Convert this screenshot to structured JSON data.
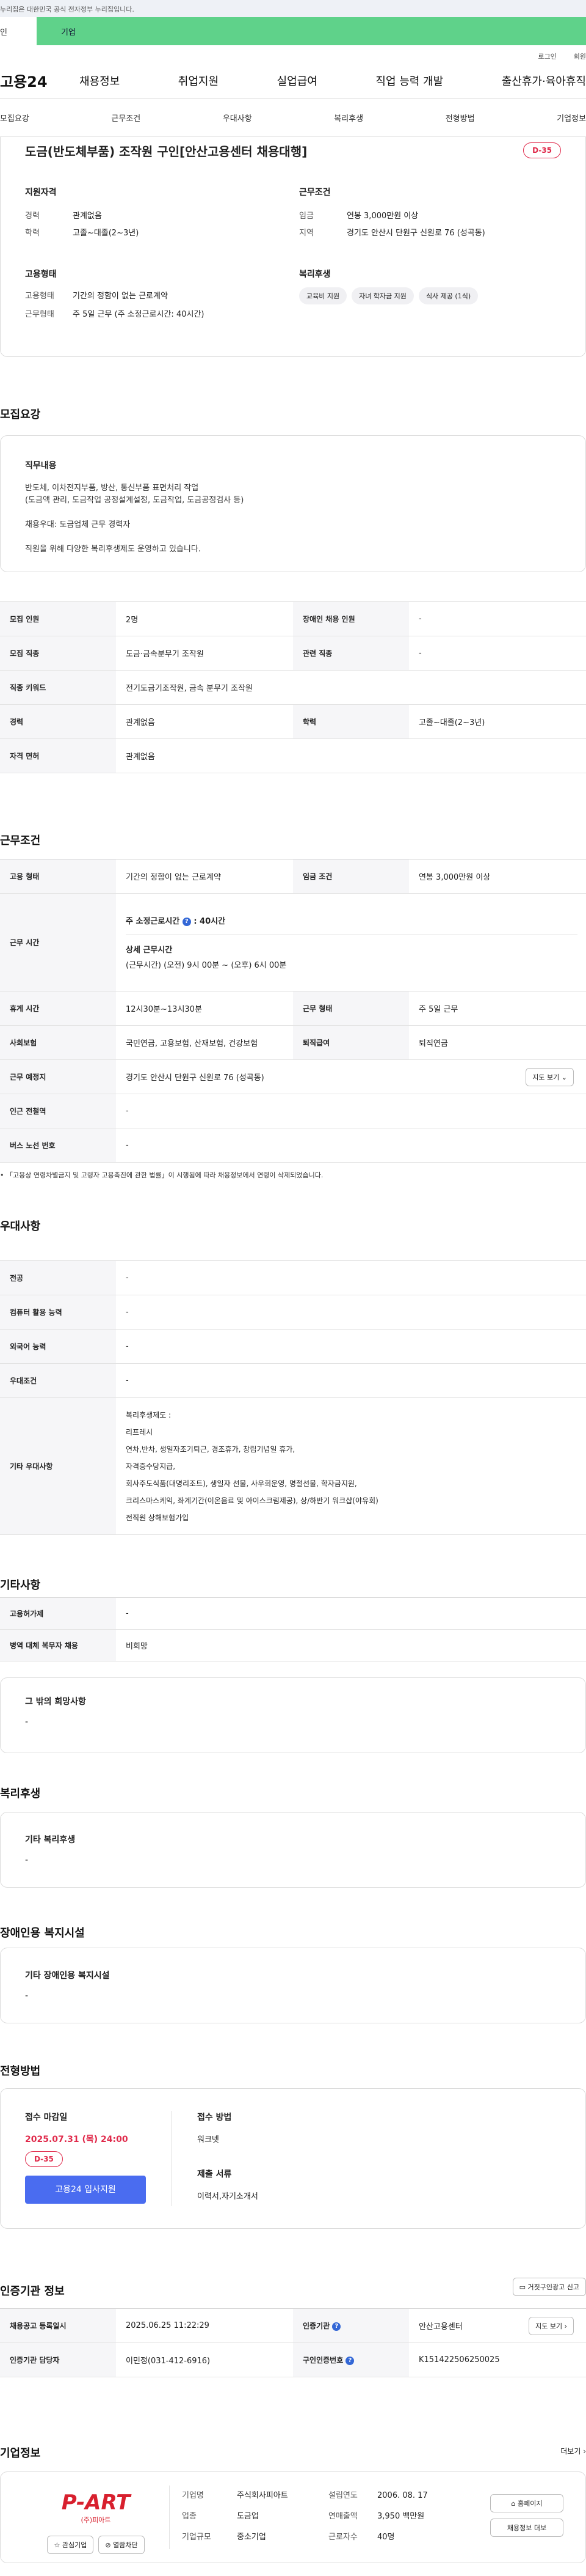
{
  "gov_bar": "누리집은 대한민국 공식 전자정부 누리집입니다.",
  "user_tabs": [
    "인",
    "기업"
  ],
  "util": [
    "로그인",
    "회원"
  ],
  "logo": "고용24",
  "gnb": [
    "채용정보",
    "취업지원",
    "실업급여",
    "직업 능력 개발",
    "출산휴가·육아휴직"
  ],
  "subnav": [
    "모집요강",
    "근무조건",
    "우대사항",
    "복리후생",
    "전형방법",
    "기업정보"
  ],
  "summary": {
    "title": "도금(반도체부품) 조작원 구인[안산고용센터 채용대행]",
    "dday": "D-35",
    "qual_title": "지원자격",
    "qual": [
      {
        "label": "경력",
        "value": "관계없음"
      },
      {
        "label": "학력",
        "value": "고졸~대졸(2~3년)"
      }
    ],
    "cond_title": "근무조건",
    "cond": [
      {
        "label": "임금",
        "value": "연봉 3,000만원 이상"
      },
      {
        "label": "지역",
        "value": "경기도 안산시 단원구 신원로 76 (성곡동)"
      }
    ],
    "emp_title": "고용형태",
    "emp": [
      {
        "label": "고용형태",
        "value": "기간의 정함이 없는 근로계약"
      },
      {
        "label": "근무형태",
        "value": "주 5일 근무 (주 소정근로시간: 40시간)"
      }
    ],
    "welfare_title": "복리후생",
    "welfare_tags": [
      "교육비 지원",
      "자녀 학자금 지원",
      "식사 제공 (1식)"
    ]
  },
  "recruit": {
    "title": "모집요강",
    "duty_title": "직무내용",
    "duty_lines": [
      "반도체, 이차전지부품, 방산, 통신부품 표면처리 작업",
      "(도금액 관리, 도금작업 공정설계설정, 도금작업, 도금공정검사 등)",
      "",
      "채용우대: 도금업체 근무 경력자",
      "",
      "직원을 위해 다양한 복리후생제도 운영하고 있습니다."
    ],
    "rows": [
      {
        "l1": "모집 인원",
        "v1": "2명",
        "l2": "장애인 채용 인원",
        "v2": "-"
      },
      {
        "l1": "모집 직종",
        "v1": "도금·금속분무기 조작원",
        "l2": "관련 직종",
        "v2": "-"
      },
      {
        "l1": "직종 키워드",
        "v1": "전기도금기조작원, 금속 분무기 조작원",
        "l2": "",
        "v2": ""
      },
      {
        "l1": "경력",
        "v1": "관계없음",
        "l2": "학력",
        "v2": "고졸~대졸(2~3년)"
      },
      {
        "l1": "자격 면허",
        "v1": "관계없음",
        "l2": "",
        "v2": ""
      }
    ]
  },
  "work": {
    "title": "근무조건",
    "emp_label": "고용 형태",
    "emp_value": "기간의 정함이 없는 근로계약",
    "wage_label": "임금 조건",
    "wage_value": "연봉 3,000만원 이상",
    "hours_label": "근무 시간",
    "hours_week": "주 소정근로시간",
    "hours_week_val": ": 40시간",
    "hours_detail_title": "상세 근무시간",
    "hours_detail": "(근무시간) (오전) 9시 00분 ~ (오후) 6시 00분",
    "break_label": "휴게 시간",
    "break_value": "12시30분~13시30분",
    "type_label": "근무 형태",
    "type_value": "주 5일 근무",
    "insure_label": "사회보험",
    "insure_value": "국민연금, 고용보험, 산재보험, 건강보험",
    "retire_label": "퇴직급여",
    "retire_value": "퇴직연금",
    "place_label": "근무 예정지",
    "place_value": "경기도 안산시 단원구 신원로 76 (성곡동)",
    "map_btn": "지도 보기",
    "subway_label": "인근 전철역",
    "subway_value": "-",
    "bus_label": "버스 노선 번호",
    "bus_value": "-",
    "note": "「고용상 연령차별금지 및 고령자 고용촉진에 관한 법률」이 시행됨에 따라 채용정보에서 연령이 삭제되었습니다."
  },
  "pref": {
    "title": "우대사항",
    "rows": [
      {
        "label": "전공",
        "value": "-"
      },
      {
        "label": "컴퓨터 활용 능력",
        "value": "-"
      },
      {
        "label": "외국어 능력",
        "value": "-"
      },
      {
        "label": "우대조건",
        "value": "-"
      }
    ],
    "other_label": "기타 우대사항",
    "other_lines": [
      "복리후생제도 :",
      "리프레시",
      "연차,반차, 생일자조기퇴근, 경조휴가, 창립기념일 휴가,",
      "자격증수당지급,",
      "회사주도식품(대명리조트), 생일자 선물, 사우회운영, 명절선물, 학자금지원,",
      "크리스마스케익, 좌계기간(이온음료 및 아이스크림제공), 상/하반기 워크샵(야유회)",
      "전직원 상해보험가입"
    ]
  },
  "etc": {
    "title": "기타사항",
    "rows": [
      {
        "label": "고용허가제",
        "value": "-"
      },
      {
        "label": "병역 대체 복무자 채용",
        "value": "비희망"
      }
    ],
    "hope_title": "그 밖의 희망사항",
    "hope_value": "-"
  },
  "benefit": {
    "title": "복리후생",
    "card_title": "기타 복리후생",
    "card_value": "-"
  },
  "disabled": {
    "title": "장애인용 복지시설",
    "card_title": "기타 장애인용 복지시설",
    "card_value": "-"
  },
  "apply": {
    "title": "전형방법",
    "deadline_title": "접수 마감일",
    "deadline": "2025.07.31 (목) 24:00",
    "dday": "D-35",
    "apply_btn": "고용24 입사지원",
    "method_title": "접수 방법",
    "method": "워크넷",
    "docs_title": "제출 서류",
    "docs": "이력서,자기소개서"
  },
  "cert": {
    "title": "인증기관 정보",
    "report_btn": "거짓구인광고 신고",
    "rows": [
      {
        "l1": "채용공고 등록일시",
        "v1": "2025.06.25 11:22:29",
        "l2": "인증기관",
        "v2": "안산고용센터",
        "btn": "지도 보기"
      },
      {
        "l1": "인증기관 담당자",
        "v1": "이민정(031-412-6916)",
        "l2": "구인인증번호",
        "v2": "K151422506250025",
        "btn": ""
      }
    ]
  },
  "company": {
    "title": "기업정보",
    "more": "더보기",
    "logo_text": "P-ART",
    "logo_sub": "(주)피아트",
    "like_btn": "관심기업",
    "block_btn": "열람차단",
    "info": [
      {
        "l1": "기업명",
        "v1": "주식회사피아트",
        "l2": "설립연도",
        "v2": "2006. 08. 17"
      },
      {
        "l1": "업종",
        "v1": "도금업",
        "l2": "연매출액",
        "v2": "3,950 백만원"
      },
      {
        "l1": "기업규모",
        "v1": "중소기업",
        "l2": "근로자수",
        "v2": "40명"
      }
    ],
    "home_btn": "홈페이지",
    "jobs_btn": "채용정보 더보"
  },
  "colors": {
    "accent_green": "#5fd28a",
    "dday_red": "#e0294a",
    "apply_blue": "#4a6cf0"
  }
}
